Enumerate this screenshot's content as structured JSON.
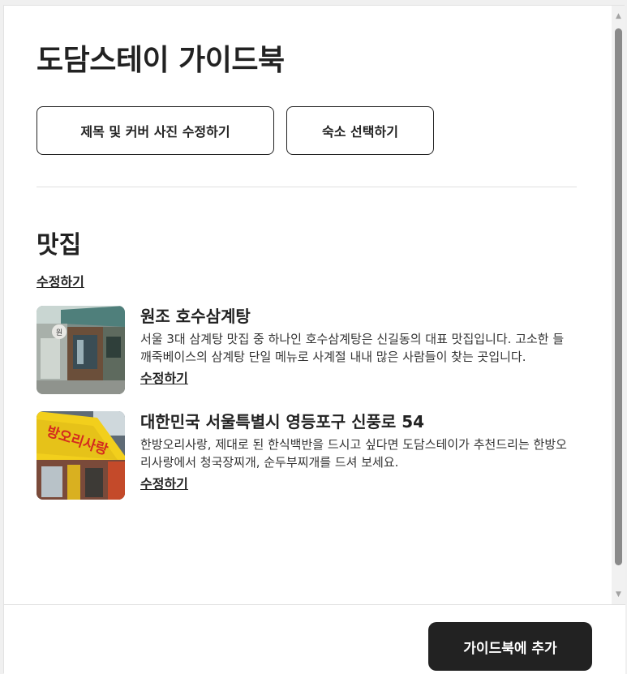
{
  "page": {
    "title": "도담스테이 가이드북"
  },
  "actions": {
    "edit_cover_label": "제목 및 커버 사진 수정하기",
    "select_stay_label": "숙소 선택하기"
  },
  "section": {
    "title": "맛집",
    "edit_label": "수정하기",
    "items": [
      {
        "title": "원조 호수삼계탕",
        "description": "서울 3대 삼계탕 맛집 중 하나인 호수삼계탕은 신길동의 대표 맛집입니다. 고소한 들깨죽베이스의 삼계탕 단일 메뉴로 사계절 내내 많은 사람들이 찾는 곳입니다.",
        "edit_label": "수정하기",
        "sign_text": "원"
      },
      {
        "title": "대한민국 서울특별시 영등포구 신풍로 54",
        "description": "한방오리사랑, 제대로 된 한식백반을 드시고 싶다면 도담스테이가 추천드리는 한방오리사랑에서 청국장찌개, 순두부찌개를 드셔 보세요.",
        "edit_label": "수정하기",
        "sign_text": "방오리사랑"
      }
    ]
  },
  "footer": {
    "primary_label": "가이드북에 추가"
  },
  "scrollbar": {
    "up_icon": "▲",
    "down_icon": "▼"
  }
}
